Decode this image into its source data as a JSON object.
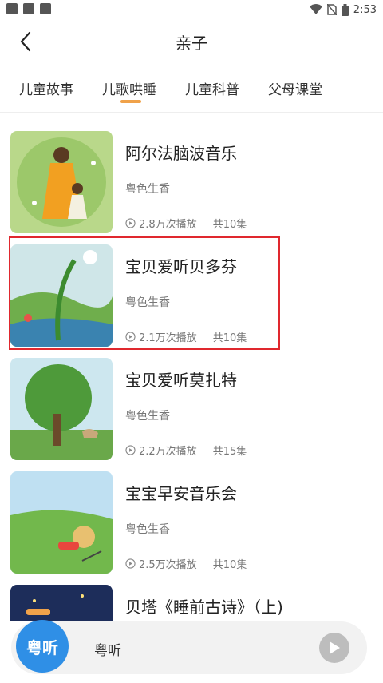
{
  "status_bar": {
    "time": "2:53"
  },
  "header": {
    "title": "亲子"
  },
  "tabs": [
    {
      "label": "儿童故事",
      "active": false
    },
    {
      "label": "儿歌哄睡",
      "active": true
    },
    {
      "label": "儿童科普",
      "active": false
    },
    {
      "label": "父母课堂",
      "active": false
    }
  ],
  "items": [
    {
      "title": "阿尔法脑波音乐",
      "author": "粤色生香",
      "plays": "2.8万次播放",
      "episodes": "共10集"
    },
    {
      "title": "宝贝爱听贝多芬",
      "author": "粤色生香",
      "plays": "2.1万次播放",
      "episodes": "共10集"
    },
    {
      "title": "宝贝爱听莫扎特",
      "author": "粤色生香",
      "plays": "2.2万次播放",
      "episodes": "共15集"
    },
    {
      "title": "宝宝早安音乐会",
      "author": "粤色生香",
      "plays": "2.5万次播放",
      "episodes": "共10集"
    },
    {
      "title": "贝塔《睡前古诗》（上)",
      "author": "",
      "plays": "",
      "episodes": ""
    }
  ],
  "player": {
    "avatar_text": "粤听",
    "label": "粤听"
  },
  "colors": {
    "accent": "#f0a24a",
    "highlight": "#e0282e",
    "player_logo": "#2f8fe6"
  }
}
